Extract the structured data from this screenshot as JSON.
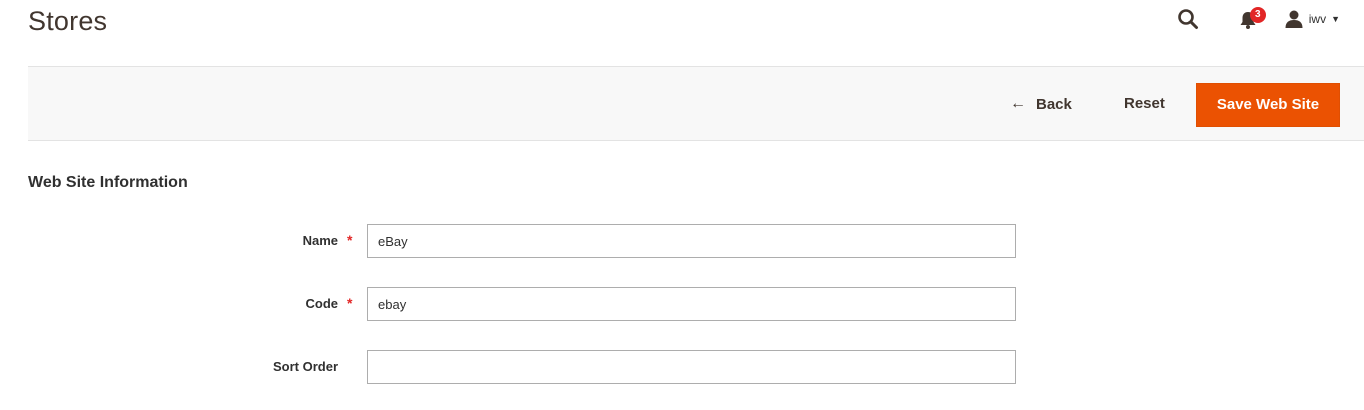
{
  "header": {
    "title": "Stores",
    "notifications_count": "3",
    "user_name": "iwv"
  },
  "actions": {
    "back_label": "Back",
    "reset_label": "Reset",
    "save_label": "Save Web Site"
  },
  "section": {
    "title": "Web Site Information"
  },
  "form": {
    "name": {
      "label": "Name",
      "required": true,
      "value": "eBay"
    },
    "code": {
      "label": "Code",
      "required": true,
      "value": "ebay"
    },
    "sort_order": {
      "label": "Sort Order",
      "required": false,
      "value": ""
    }
  },
  "colors": {
    "accent": "#eb5202",
    "required": "#e22626",
    "toolbar_bg": "#f8f8f8"
  }
}
